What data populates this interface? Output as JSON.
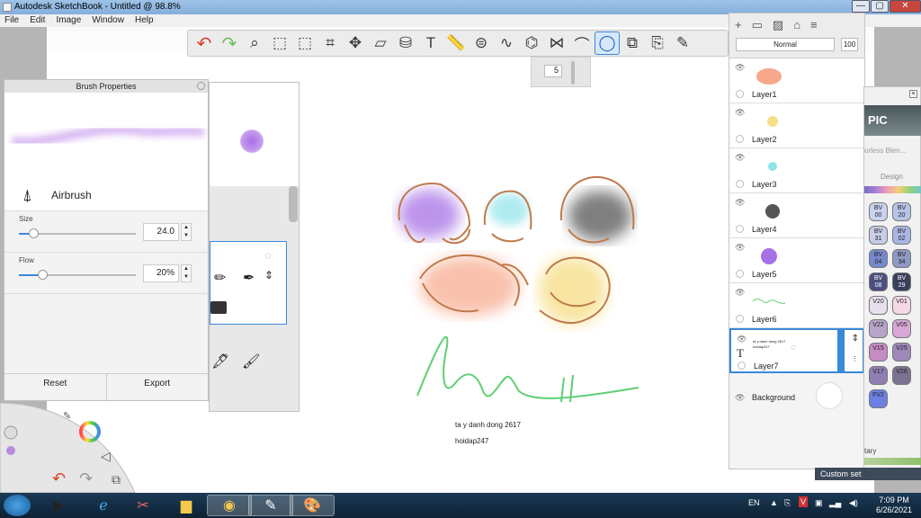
{
  "window": {
    "title": "Autodesk SketchBook - Untitled @ 98.8%",
    "min_label": "—",
    "max_label": "▢",
    "close_label": "✕"
  },
  "menu": [
    "File",
    "Edit",
    "Image",
    "Window",
    "Help"
  ],
  "toolbar": {
    "tools": [
      "undo-icon",
      "redo-icon",
      "zoom-icon",
      "rect-select-icon",
      "lasso-select-icon",
      "crop-icon",
      "transform-icon",
      "distort-icon",
      "fill-icon",
      "text-icon",
      "ruler-icon",
      "ellipse-guide-icon",
      "french-curve-icon",
      "perspective-icon",
      "symmetry-icon",
      "stroke-icon",
      "predictive-stroke-icon",
      "shape-icon",
      "copy-icon",
      "brush-icon"
    ],
    "active_tool": "predictive-stroke-icon"
  },
  "brush_size_popup": {
    "value": "5"
  },
  "brush_properties": {
    "title": "Brush Properties",
    "brush_name": "Airbrush",
    "size_label": "Size",
    "size_value": "24.0",
    "size_fraction": 0.12,
    "flow_label": "Flow",
    "flow_value": "20%",
    "flow_fraction": 0.2,
    "reset_label": "Reset",
    "export_label": "Export"
  },
  "canvas_text": {
    "line1": "ta y danh dong 2617",
    "line2": "hoidap247"
  },
  "layers_panel": {
    "blend_mode": "Normal",
    "opacity": "100",
    "layers": [
      {
        "name": "Layer1",
        "selected": false
      },
      {
        "name": "Layer2",
        "selected": false
      },
      {
        "name": "Layer3",
        "selected": false
      },
      {
        "name": "Layer4",
        "selected": false
      },
      {
        "name": "Layer5",
        "selected": false
      },
      {
        "name": "Layer6",
        "selected": false
      },
      {
        "name": "Layer7",
        "selected": true
      }
    ],
    "background_label": "Background",
    "layer7_text_lines": [
      "ta y danh dong 2617",
      "hoidap247"
    ]
  },
  "copic": {
    "logo": "PIC",
    "category_hint": "orless Blen...",
    "design_label": "Design",
    "swatches": [
      {
        "code": "BV\n00",
        "color": "#c9d3ef"
      },
      {
        "code": "BV\n20",
        "color": "#b5c4e6"
      },
      {
        "code": "BV\n31",
        "color": "#c7cce8"
      },
      {
        "code": "BV\n02",
        "color": "#a9b6e4"
      },
      {
        "code": "BV\n04",
        "color": "#7589cc"
      },
      {
        "code": "BV\n34",
        "color": "#8e99c4"
      },
      {
        "code": "BV\n08",
        "color": "#4b4e7f"
      },
      {
        "code": "BV\n29",
        "color": "#3a3f5c"
      },
      {
        "code": "V20",
        "color": "#e7e0ef"
      },
      {
        "code": "V01",
        "color": "#f4d8e6"
      },
      {
        "code": "V22",
        "color": "#b6a4c9"
      },
      {
        "code": "V05",
        "color": "#d8a8d6"
      },
      {
        "code": "V15",
        "color": "#c58bc3"
      },
      {
        "code": "V25",
        "color": "#9d88b8"
      },
      {
        "code": "V17",
        "color": "#8f7eb2"
      },
      {
        "code": "V28",
        "color": "#7d7191"
      },
      {
        "code": "FV2",
        "color": "#6e7fe2"
      }
    ],
    "bottom_label": "tary",
    "custom_set_label": "Custom set"
  },
  "taskbar": {
    "language": "EN",
    "time": "7:09 PM",
    "date": "6/26/2021"
  },
  "colors": {
    "accent": "#3a88d8",
    "lagoon_color": "#b98ae0"
  }
}
